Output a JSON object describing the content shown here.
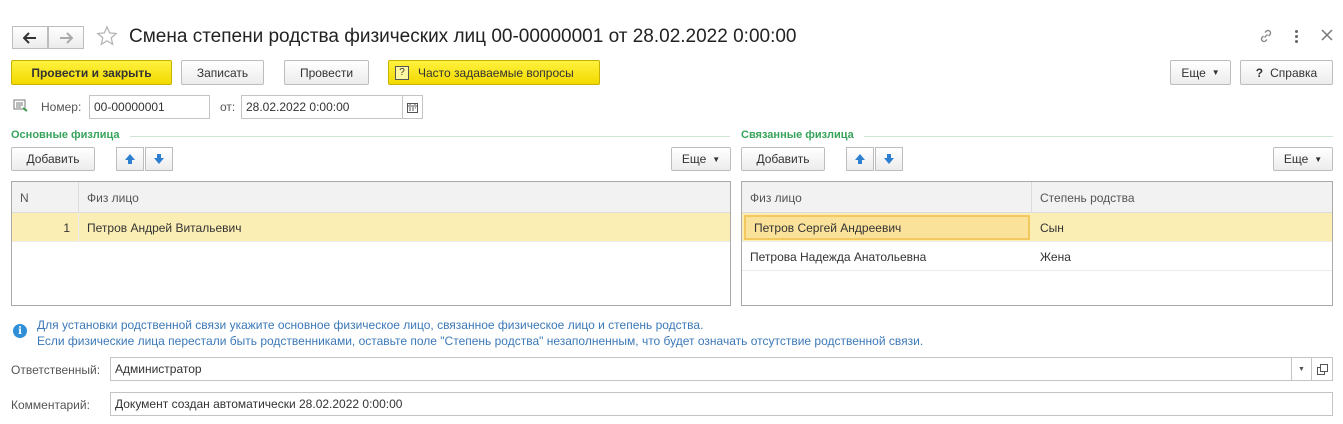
{
  "header": {
    "title": "Смена степени родства физических лиц 00-00000001 от 28.02.2022 0:00:00",
    "back_icon": "arrow-left-icon",
    "forward_icon": "arrow-right-icon",
    "star_icon": "star-icon",
    "link_icon": "link-icon",
    "more_icon": "kebab-icon",
    "close_icon": "close-icon"
  },
  "toolbar": {
    "post_close_label": "Провести и закрыть",
    "save_label": "Записать",
    "post_label": "Провести",
    "faq_label": "Часто задаваемые вопросы",
    "faq_icon": "?",
    "more_label": "Еще",
    "help_label": "Справка",
    "help_icon": "?"
  },
  "doc": {
    "number_label": "Номер:",
    "number_value": "00-00000001",
    "date_label": "от:",
    "date_value": "28.02.2022  0:00:00"
  },
  "main_persons": {
    "title": "Основные физлица",
    "add_label": "Добавить",
    "more_label": "Еще",
    "columns": [
      "N",
      "Физ лицо"
    ],
    "rows": [
      {
        "n": "1",
        "person": "Петров Андрей Витальевич"
      }
    ]
  },
  "related_persons": {
    "title": "Связанные физлица",
    "add_label": "Добавить",
    "more_label": "Еще",
    "columns": [
      "Физ лицо",
      "Степень родства"
    ],
    "rows": [
      {
        "person": "Петров Сергей Андреевич",
        "relation": "Сын"
      },
      {
        "person": "Петрова Надежда Анатольевна",
        "relation": "Жена"
      }
    ]
  },
  "info": {
    "line1": "Для установки родственной связи укажите основное физическое лицо, связанное физическое лицо и степень родства.",
    "line2": "Если физические лица перестали быть родственниками, оставьте поле \"Степень родства\" незаполненным, что будет означать отсутствие родственной связи."
  },
  "footer": {
    "responsible_label": "Ответственный:",
    "responsible_value": "Администратор",
    "comment_label": "Комментарий:",
    "comment_value": "Документ создан автоматически 28.02.2022 0:00:00"
  },
  "colors": {
    "accent_yellow": "#f2d900",
    "section_green": "#38a35b",
    "selected_row": "#fbeeb4",
    "info_blue": "#3c79b8"
  }
}
